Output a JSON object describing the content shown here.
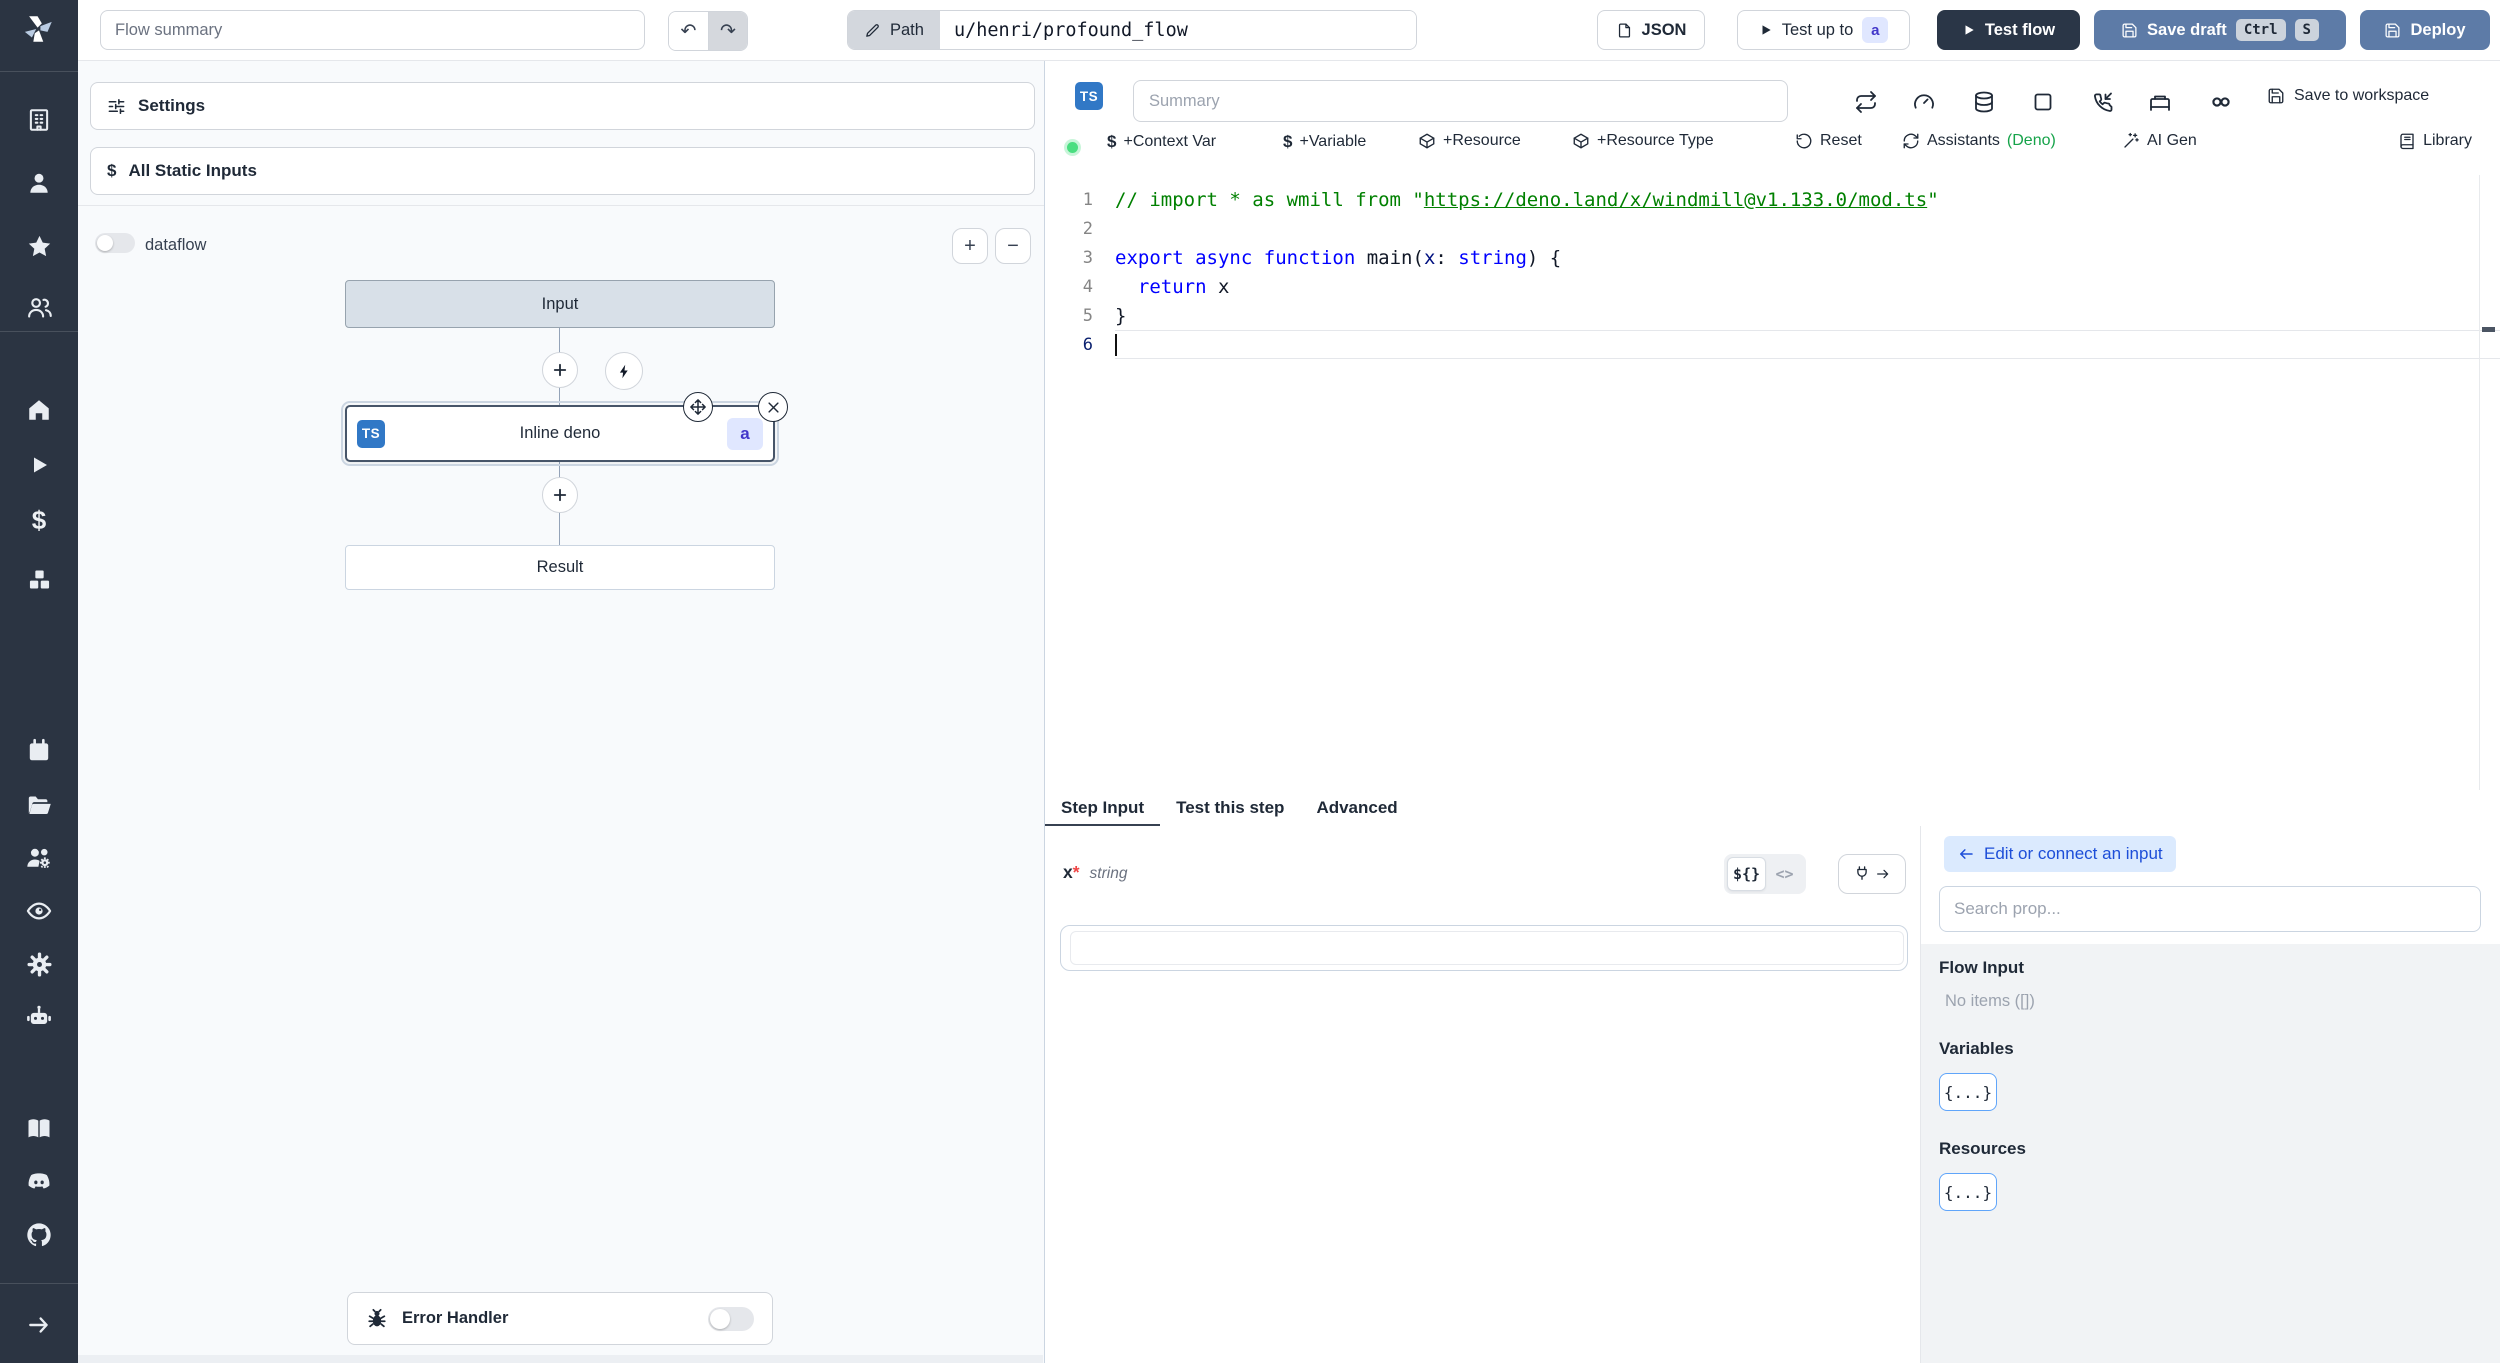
{
  "colors": {
    "sidebar_bg": "#2b3442",
    "ts_badge_blue": "#3178c6",
    "steel_blue_button": "#5d7ba7",
    "dark_navy_button": "#2a3647",
    "badge_indigo_bg": "#e0e7ff",
    "badge_indigo_text": "#4338ca",
    "status_green": "#4ade80",
    "assistants_green": "#16a34a",
    "link_blue": "#1d4ed8",
    "code_comment": "#008000",
    "code_keyword": "#0000ff"
  },
  "sidebar": {
    "icons": [
      "windmill-logo",
      "building",
      "user",
      "star",
      "users",
      "home",
      "play",
      "dollar",
      "cubes",
      "calendar",
      "folder-open",
      "users-cog",
      "eye",
      "gear",
      "robot",
      "book",
      "discord",
      "github",
      "arrow-right"
    ]
  },
  "topbar": {
    "flow_summary_placeholder": "Flow summary",
    "path_label": "Path",
    "path_value": "u/henri/profound_flow",
    "json_button": "JSON",
    "test_up_to": "Test up to",
    "test_up_to_badge": "a",
    "test_flow": "Test flow",
    "save_draft": "Save draft",
    "kbd_ctrl": "Ctrl",
    "kbd_s": "S",
    "deploy": "Deploy"
  },
  "flow_panel": {
    "settings_label": "Settings",
    "all_static_inputs_label": "All Static Inputs",
    "dataflow_label": "dataflow",
    "zoom_in_label": "+",
    "zoom_out_label": "−",
    "input_node": "Input",
    "step_node": "Inline deno",
    "step_lang_badge": "TS",
    "step_id_badge": "a",
    "result_node": "Result",
    "error_handler_label": "Error Handler"
  },
  "editor": {
    "lang_badge": "TS",
    "summary_placeholder": "Summary",
    "save_to_workspace": "Save to workspace",
    "actions": [
      {
        "label": "+Context Var"
      },
      {
        "label": "+Variable"
      },
      {
        "label": "+Resource"
      },
      {
        "label": "+Resource Type"
      },
      {
        "label": "Reset"
      },
      {
        "label": "Assistants",
        "suffix": "(Deno)"
      },
      {
        "label": "AI Gen"
      }
    ],
    "library_label": "Library",
    "code": {
      "lines": [
        {
          "num": 1,
          "active": false,
          "tokens": [
            {
              "t": "// import * as wmill from \"",
              "c": "comment"
            },
            {
              "t": "https://deno.land/x/windmill@v1.133.0/mod.ts",
              "c": "comment-link"
            },
            {
              "t": "\"",
              "c": "comment"
            }
          ]
        },
        {
          "num": 2,
          "active": false,
          "tokens": []
        },
        {
          "num": 3,
          "active": false,
          "tokens": [
            {
              "t": "export",
              "c": "keyword"
            },
            {
              "t": " ",
              "c": "plain"
            },
            {
              "t": "async",
              "c": "keyword"
            },
            {
              "t": " ",
              "c": "plain"
            },
            {
              "t": "function",
              "c": "keyword"
            },
            {
              "t": " ",
              "c": "plain"
            },
            {
              "t": "main",
              "c": "function"
            },
            {
              "t": "(",
              "c": "plain"
            },
            {
              "t": "x",
              "c": "param"
            },
            {
              "t": ": ",
              "c": "plain"
            },
            {
              "t": "string",
              "c": "type"
            },
            {
              "t": ") {",
              "c": "plain"
            }
          ]
        },
        {
          "num": 4,
          "active": false,
          "tokens": [
            {
              "t": "  ",
              "c": "plain"
            },
            {
              "t": "return",
              "c": "keyword"
            },
            {
              "t": " x",
              "c": "plain"
            }
          ]
        },
        {
          "num": 5,
          "active": false,
          "tokens": [
            {
              "t": "}",
              "c": "plain"
            }
          ]
        },
        {
          "num": 6,
          "active": true,
          "tokens": []
        }
      ]
    }
  },
  "step_panel": {
    "tabs": [
      {
        "label": "Step Input"
      },
      {
        "label": "Test this step"
      },
      {
        "label": "Advanced"
      }
    ],
    "arg_name": "x",
    "required_marker": "*",
    "arg_type": "string",
    "template_mode": "${}",
    "code_mode": "<>",
    "input_value": ""
  },
  "connect_panel": {
    "back_label": "Edit or connect an input",
    "search_placeholder": "Search prop...",
    "flow_input_title": "Flow Input",
    "flow_input_empty": "No items ([])",
    "variables_title": "Variables",
    "variables_chip": "{...}",
    "resources_title": "Resources",
    "resources_chip": "{...}"
  }
}
